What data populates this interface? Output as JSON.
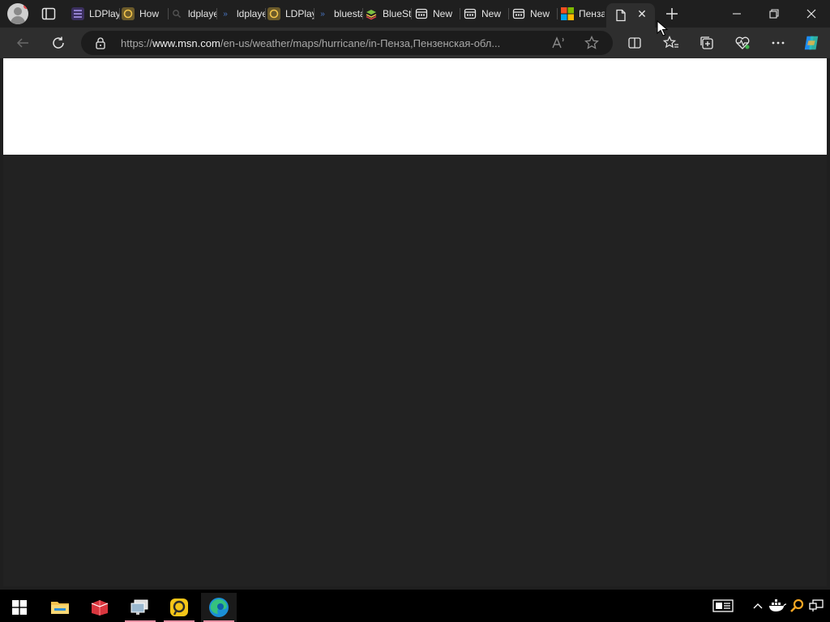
{
  "tabs": [
    {
      "label": "LDPlayer",
      "favicon": "list-icon",
      "color": "#7b5ad9"
    },
    {
      "label": "How",
      "favicon": "ldplayer-icon",
      "color": "#e0a92a"
    },
    {
      "label": "ldplayer",
      "favicon": "search-icon",
      "color": "#3a78d8"
    },
    {
      "label": "ldplayer",
      "favicon": "bing-icon",
      "color": "#3a78d8"
    },
    {
      "label": "LDPlayer",
      "favicon": "ldplayer-icon",
      "color": "#e0a92a"
    },
    {
      "label": "bluestacks",
      "favicon": "bing-icon",
      "color": "#3a78d8"
    },
    {
      "label": "BlueStacks",
      "favicon": "bluestacks-icon",
      "color": "#7cc242"
    },
    {
      "label": "New",
      "favicon": "newtab-icon",
      "color": "#e6e6e6"
    },
    {
      "label": "New",
      "favicon": "newtab-icon",
      "color": "#e6e6e6"
    },
    {
      "label": "New",
      "favicon": "newtab-icon",
      "color": "#e6e6e6"
    },
    {
      "label": "Пенза",
      "favicon": "microsoft-icon",
      "color": "#f25022"
    }
  ],
  "address_bar": {
    "prefix": "https://",
    "host": "www.msn.com",
    "path": "/en-us/weather/maps/hurricane/in-Пенза,Пензенская-обл..."
  },
  "taskbar": {
    "apps": [
      "start-icon",
      "file-explorer-icon",
      "app-icon",
      "app-icon",
      "ldplayer-icon",
      "edge-icon"
    ]
  },
  "colors": {
    "titlebar": "#1f1f1f",
    "toolbar": "#2e2e2e",
    "content_top": "#ffffff",
    "content_main": "#222222",
    "taskbar": "#000000",
    "accent": "#e88fa3"
  }
}
